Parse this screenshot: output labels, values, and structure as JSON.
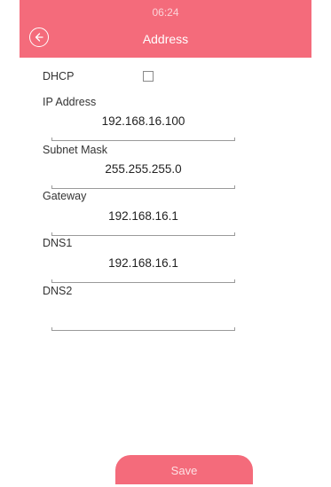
{
  "status_bar": {
    "time": "06:24"
  },
  "header": {
    "title": "Address",
    "back_icon": "back-arrow-circle-icon"
  },
  "form": {
    "dhcp": {
      "label": "DHCP",
      "checked": false
    },
    "ip_address": {
      "label": "IP Address",
      "value": "192.168.16.100"
    },
    "subnet_mask": {
      "label": "Subnet Mask",
      "value": "255.255.255.0"
    },
    "gateway": {
      "label": "Gateway",
      "value": "192.168.16.1"
    },
    "dns1": {
      "label": "DNS1",
      "value": "192.168.16.1"
    },
    "dns2": {
      "label": "DNS2",
      "value": ""
    }
  },
  "actions": {
    "save_label": "Save"
  },
  "colors": {
    "accent": "#f46b7b",
    "status_text": "#fbd3d8"
  }
}
